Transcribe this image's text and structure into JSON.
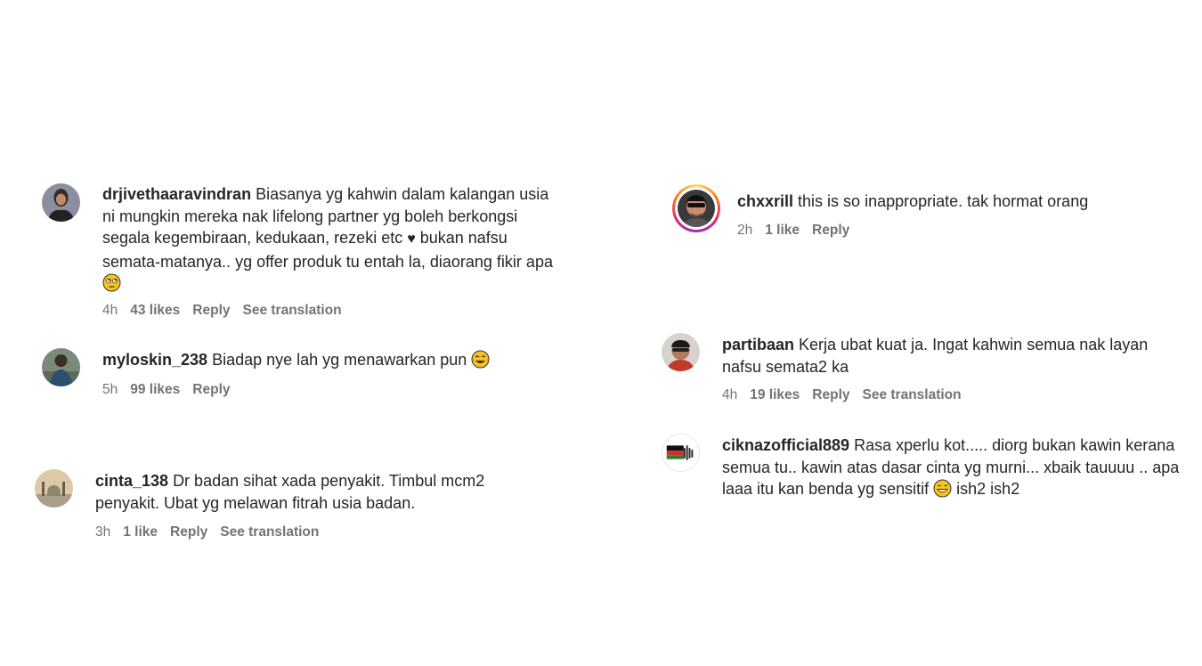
{
  "comments": [
    {
      "username": "drjivethaaravindran",
      "text_parts": [
        "Biasanya yg kahwin dalam kalangan usia ni mungkin mereka nak lifelong partner yg boleh berkongsi segala kegembiraan, kedukaan, rezeki etc ",
        "♥",
        " bukan nafsu semata-matanya.. yg offer produk tu entah la, diaorang fikir apa "
      ],
      "emoji": "face-with-rolling-eyes",
      "time": "4h",
      "likes": "43 likes",
      "reply": "Reply",
      "translate": "See translation"
    },
    {
      "username": "myloskin_238",
      "text": "Biadap nye lah yg menawarkan pun ",
      "emoji": "face-with-tears-of-joy",
      "time": "5h",
      "likes": "99 likes",
      "reply": "Reply"
    },
    {
      "username": "cinta_138",
      "text": "Dr badan sihat xada penyakit. Timbul mcm2 penyakit. Ubat yg melawan fitrah usia badan.",
      "time": "3h",
      "likes": "1 like",
      "reply": "Reply",
      "translate": "See translation"
    },
    {
      "username": "chxxrill",
      "text": "this is so inappropriate. tak hormat orang",
      "time": "2h",
      "likes": "1 like",
      "reply": "Reply"
    },
    {
      "username": "partibaan",
      "text": "Kerja ubat kuat ja. Ingat kahwin semua nak layan nafsu semata2 ka",
      "time": "4h",
      "likes": "19 likes",
      "reply": "Reply",
      "translate": "See translation"
    },
    {
      "username": "ciknazofficial889",
      "text_parts": [
        "Rasa xperlu kot..... diorg bukan kawin kerana semua tu.. kawin atas dasar cinta yg murni... xbaik tauuuu .. apa laaa itu kan benda yg sensitif ",
        " ish2 ish2"
      ],
      "emoji": "grinning-face-with-sweat",
      "avatar_text": "#SAVE PALESTINE"
    }
  ],
  "colors": {
    "text": "#262626",
    "meta": "#737373",
    "story_ring": [
      "#feda75",
      "#fa7e1e",
      "#d62976",
      "#962fbf"
    ]
  }
}
